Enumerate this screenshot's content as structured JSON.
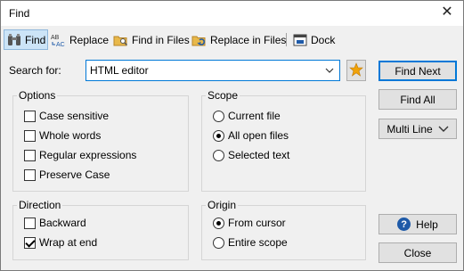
{
  "window": {
    "title": "Find"
  },
  "toolbar": {
    "find": "Find",
    "replace": "Replace",
    "find_in_files": "Find in Files",
    "replace_in_files": "Replace in Files",
    "dock": "Dock"
  },
  "search": {
    "label": "Search for:",
    "value": "HTML editor"
  },
  "options": {
    "title": "Options",
    "case_sensitive": "Case sensitive",
    "whole_words": "Whole words",
    "regular_expressions": "Regular expressions",
    "preserve_case": "Preserve Case"
  },
  "scope": {
    "title": "Scope",
    "current_file": "Current file",
    "all_open_files": "All open files",
    "selected_text": "Selected text"
  },
  "direction": {
    "title": "Direction",
    "backward": "Backward",
    "wrap_at_end": "Wrap at end"
  },
  "origin": {
    "title": "Origin",
    "from_cursor": "From cursor",
    "entire_scope": "Entire scope"
  },
  "buttons": {
    "find_next": "Find Next",
    "find_all": "Find All",
    "multi_line": "Multi Line",
    "help": "Help",
    "close": "Close"
  },
  "state": {
    "case_sensitive": false,
    "whole_words": false,
    "regular_expressions": false,
    "preserve_case": false,
    "scope_selected": "All open files",
    "backward": false,
    "wrap_at_end": true,
    "origin_selected": "From cursor"
  },
  "colors": {
    "accent": "#0078d7",
    "active_tab": "#cce4f7",
    "star": "#f0a30a",
    "help_icon": "#1e5aa8"
  }
}
